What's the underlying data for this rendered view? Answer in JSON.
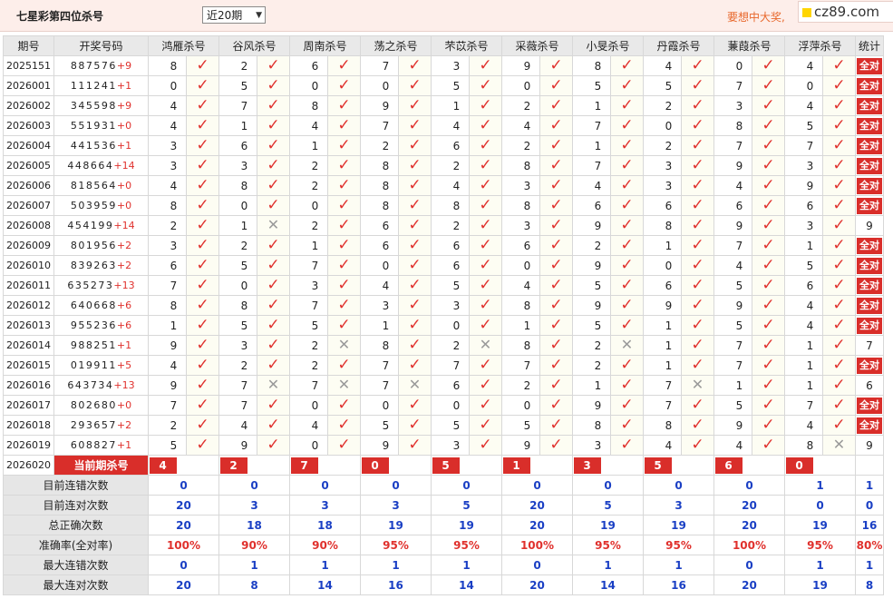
{
  "header": {
    "title": "七星彩第四位杀号",
    "period_select": "近20期",
    "ad_text": "要想中大奖,",
    "watermark": "cz89.com"
  },
  "columns": {
    "issue": "期号",
    "draw": "开奖号码",
    "experts": [
      "鸿雁杀号",
      "谷风杀号",
      "周南杀号",
      "荡之杀号",
      "芣苡杀号",
      "采薇杀号",
      "小旻杀号",
      "丹霞杀号",
      "蒹葭杀号",
      "浮萍杀号"
    ],
    "stat": "统计"
  },
  "rows": [
    {
      "issue": "2025151",
      "digits": "887576",
      "sum": "+9",
      "kills": [
        8,
        2,
        6,
        7,
        3,
        9,
        8,
        4,
        0,
        4
      ],
      "ok": [
        1,
        1,
        1,
        1,
        1,
        1,
        1,
        1,
        1,
        1
      ],
      "stat": "全对"
    },
    {
      "issue": "2026001",
      "digits": "111241",
      "sum": "+1",
      "kills": [
        0,
        5,
        0,
        0,
        5,
        0,
        5,
        5,
        7,
        0
      ],
      "ok": [
        1,
        1,
        1,
        1,
        1,
        1,
        1,
        1,
        1,
        1
      ],
      "stat": "全对"
    },
    {
      "issue": "2026002",
      "digits": "345598",
      "sum": "+9",
      "kills": [
        4,
        7,
        8,
        9,
        1,
        2,
        1,
        2,
        3,
        4
      ],
      "ok": [
        1,
        1,
        1,
        1,
        1,
        1,
        1,
        1,
        1,
        1
      ],
      "stat": "全对"
    },
    {
      "issue": "2026003",
      "digits": "551931",
      "sum": "+0",
      "kills": [
        4,
        1,
        4,
        7,
        4,
        4,
        7,
        0,
        8,
        5
      ],
      "ok": [
        1,
        1,
        1,
        1,
        1,
        1,
        1,
        1,
        1,
        1
      ],
      "stat": "全对"
    },
    {
      "issue": "2026004",
      "digits": "441536",
      "sum": "+1",
      "kills": [
        3,
        6,
        1,
        2,
        6,
        2,
        1,
        2,
        7,
        7
      ],
      "ok": [
        1,
        1,
        1,
        1,
        1,
        1,
        1,
        1,
        1,
        1
      ],
      "stat": "全对"
    },
    {
      "issue": "2026005",
      "digits": "448664",
      "sum": "+14",
      "kills": [
        3,
        3,
        2,
        8,
        2,
        8,
        7,
        3,
        9,
        3
      ],
      "ok": [
        1,
        1,
        1,
        1,
        1,
        1,
        1,
        1,
        1,
        1
      ],
      "stat": "全对"
    },
    {
      "issue": "2026006",
      "digits": "818564",
      "sum": "+0",
      "kills": [
        4,
        8,
        2,
        8,
        4,
        3,
        4,
        3,
        4,
        9
      ],
      "ok": [
        1,
        1,
        1,
        1,
        1,
        1,
        1,
        1,
        1,
        1
      ],
      "stat": "全对"
    },
    {
      "issue": "2026007",
      "digits": "503959",
      "sum": "+0",
      "kills": [
        8,
        0,
        0,
        8,
        8,
        8,
        6,
        6,
        6,
        6
      ],
      "ok": [
        1,
        1,
        1,
        1,
        1,
        1,
        1,
        1,
        1,
        1
      ],
      "stat": "全对"
    },
    {
      "issue": "2026008",
      "digits": "454199",
      "sum": "+14",
      "kills": [
        2,
        1,
        2,
        6,
        2,
        3,
        9,
        8,
        9,
        3
      ],
      "ok": [
        1,
        0,
        1,
        1,
        1,
        1,
        1,
        1,
        1,
        1
      ],
      "stat": "9"
    },
    {
      "issue": "2026009",
      "digits": "801956",
      "sum": "+2",
      "kills": [
        3,
        2,
        1,
        6,
        6,
        6,
        2,
        1,
        7,
        1
      ],
      "ok": [
        1,
        1,
        1,
        1,
        1,
        1,
        1,
        1,
        1,
        1
      ],
      "stat": "全对"
    },
    {
      "issue": "2026010",
      "digits": "839263",
      "sum": "+2",
      "kills": [
        6,
        5,
        7,
        0,
        6,
        0,
        9,
        0,
        4,
        5
      ],
      "ok": [
        1,
        1,
        1,
        1,
        1,
        1,
        1,
        1,
        1,
        1
      ],
      "stat": "全对"
    },
    {
      "issue": "2026011",
      "digits": "635273",
      "sum": "+13",
      "kills": [
        7,
        0,
        3,
        4,
        5,
        4,
        5,
        6,
        5,
        6
      ],
      "ok": [
        1,
        1,
        1,
        1,
        1,
        1,
        1,
        1,
        1,
        1
      ],
      "stat": "全对"
    },
    {
      "issue": "2026012",
      "digits": "640668",
      "sum": "+6",
      "kills": [
        8,
        8,
        7,
        3,
        3,
        8,
        9,
        9,
        9,
        4
      ],
      "ok": [
        1,
        1,
        1,
        1,
        1,
        1,
        1,
        1,
        1,
        1
      ],
      "stat": "全对"
    },
    {
      "issue": "2026013",
      "digits": "955236",
      "sum": "+6",
      "kills": [
        1,
        5,
        5,
        1,
        0,
        1,
        5,
        1,
        5,
        4
      ],
      "ok": [
        1,
        1,
        1,
        1,
        1,
        1,
        1,
        1,
        1,
        1
      ],
      "stat": "全对"
    },
    {
      "issue": "2026014",
      "digits": "988251",
      "sum": "+1",
      "kills": [
        9,
        3,
        2,
        8,
        2,
        8,
        2,
        1,
        7,
        1
      ],
      "ok": [
        1,
        1,
        0,
        1,
        0,
        1,
        0,
        1,
        1,
        1
      ],
      "stat": "7"
    },
    {
      "issue": "2026015",
      "digits": "019911",
      "sum": "+5",
      "kills": [
        4,
        2,
        2,
        7,
        7,
        7,
        2,
        1,
        7,
        1
      ],
      "ok": [
        1,
        1,
        1,
        1,
        1,
        1,
        1,
        1,
        1,
        1
      ],
      "stat": "全对"
    },
    {
      "issue": "2026016",
      "digits": "643734",
      "sum": "+13",
      "kills": [
        9,
        7,
        7,
        7,
        6,
        2,
        1,
        7,
        1,
        1
      ],
      "ok": [
        1,
        0,
        0,
        0,
        1,
        1,
        1,
        0,
        1,
        1
      ],
      "stat": "6"
    },
    {
      "issue": "2026017",
      "digits": "802680",
      "sum": "+0",
      "kills": [
        7,
        7,
        0,
        0,
        0,
        0,
        9,
        7,
        5,
        7
      ],
      "ok": [
        1,
        1,
        1,
        1,
        1,
        1,
        1,
        1,
        1,
        1
      ],
      "stat": "全对"
    },
    {
      "issue": "2026018",
      "digits": "293657",
      "sum": "+2",
      "kills": [
        2,
        4,
        4,
        5,
        5,
        5,
        8,
        8,
        9,
        4
      ],
      "ok": [
        1,
        1,
        1,
        1,
        1,
        1,
        1,
        1,
        1,
        1
      ],
      "stat": "全对"
    },
    {
      "issue": "2026019",
      "digits": "608827",
      "sum": "+1",
      "kills": [
        5,
        9,
        0,
        9,
        3,
        9,
        3,
        4,
        4,
        8
      ],
      "ok": [
        1,
        1,
        1,
        1,
        1,
        1,
        1,
        1,
        1,
        0
      ],
      "stat": "9"
    }
  ],
  "current": {
    "issue": "2026020",
    "label": "当前期杀号",
    "kills": [
      4,
      2,
      7,
      0,
      5,
      1,
      3,
      5,
      6,
      0
    ]
  },
  "summary": [
    {
      "label": "目前连错次数",
      "values": [
        "0",
        "0",
        "0",
        "0",
        "0",
        "0",
        "0",
        "0",
        "0",
        "1",
        "1"
      ],
      "color": "blue"
    },
    {
      "label": "目前连对次数",
      "values": [
        "20",
        "3",
        "3",
        "3",
        "5",
        "20",
        "5",
        "3",
        "20",
        "0",
        "0"
      ],
      "color": "blue"
    },
    {
      "label": "总正确次数",
      "values": [
        "20",
        "18",
        "18",
        "19",
        "19",
        "20",
        "19",
        "19",
        "20",
        "19",
        "16"
      ],
      "color": "blue"
    },
    {
      "label": "准确率(全对率)",
      "values": [
        "100%",
        "90%",
        "90%",
        "95%",
        "95%",
        "100%",
        "95%",
        "95%",
        "100%",
        "95%",
        "80%"
      ],
      "color": "red"
    },
    {
      "label": "最大连错次数",
      "values": [
        "0",
        "1",
        "1",
        "1",
        "1",
        "0",
        "1",
        "1",
        "0",
        "1",
        "1"
      ],
      "color": "blue"
    },
    {
      "label": "最大连对次数",
      "values": [
        "20",
        "8",
        "14",
        "16",
        "14",
        "20",
        "14",
        "16",
        "20",
        "19",
        "8"
      ],
      "color": "blue"
    }
  ],
  "icons": {
    "correct": "check-icon",
    "wrong": "cross-icon"
  }
}
